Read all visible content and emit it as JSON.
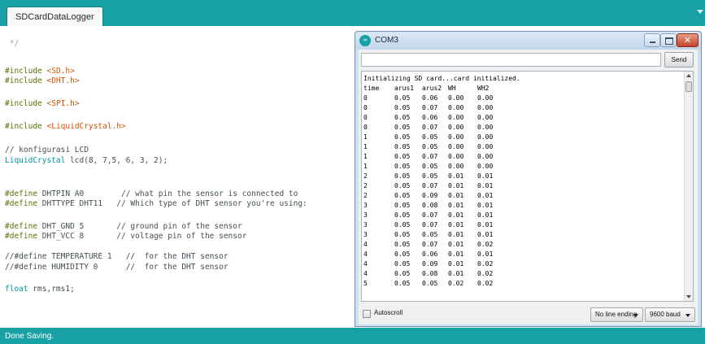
{
  "editor": {
    "tab_label": "SDCardDataLogger",
    "code_lines": [
      " */",
      "#include <SD.h>",
      "#include <DHT.h>",
      "#include <SPI.h>",
      "#include <LiquidCrystal.h>",
      "// konfigurasi LCD",
      "LiquidCrystal lcd(8, 7,5, 6, 3, 2);",
      "#define DHTPIN A0        // what pin the sensor is connected to",
      "#define DHTTYPE DHT11   // Which type of DHT sensor you're using:",
      "#define DHT_GND 5       // ground pin of the sensor",
      "#define DHT_VCC 8       // voltage pin of the sensor",
      "//#define TEMPERATURE 1   //  for the DHT sensor",
      "//#define HUMIDITY 0      //  for the DHT sensor",
      "float rms,rms1;"
    ]
  },
  "status": {
    "text": "Done Saving."
  },
  "serial_monitor": {
    "title": "COM3",
    "icon_text": "∞",
    "send_label": "Send",
    "init_line": "Initializing SD card...card initialized.",
    "columns": [
      "time",
      "arus1",
      "arus2",
      "WH",
      "WH2"
    ],
    "rows": [
      [
        "0",
        "0.05",
        "0.06",
        "0.00",
        "0.00"
      ],
      [
        "0",
        "0.05",
        "0.07",
        "0.00",
        "0.00"
      ],
      [
        "0",
        "0.05",
        "0.06",
        "0.00",
        "0.00"
      ],
      [
        "0",
        "0.05",
        "0.07",
        "0.00",
        "0.00"
      ],
      [
        "1",
        "0.05",
        "0.05",
        "0.00",
        "0.00"
      ],
      [
        "1",
        "0.05",
        "0.05",
        "0.00",
        "0.00"
      ],
      [
        "1",
        "0.05",
        "0.07",
        "0.00",
        "0.00"
      ],
      [
        "1",
        "0.05",
        "0.05",
        "0.00",
        "0.00"
      ],
      [
        "2",
        "0.05",
        "0.05",
        "0.01",
        "0.01"
      ],
      [
        "2",
        "0.05",
        "0.07",
        "0.01",
        "0.01"
      ],
      [
        "2",
        "0.05",
        "0.09",
        "0.01",
        "0.01"
      ],
      [
        "3",
        "0.05",
        "0.08",
        "0.01",
        "0.01"
      ],
      [
        "3",
        "0.05",
        "0.07",
        "0.01",
        "0.01"
      ],
      [
        "3",
        "0.05",
        "0.07",
        "0.01",
        "0.01"
      ],
      [
        "3",
        "0.05",
        "0.05",
        "0.01",
        "0.01"
      ],
      [
        "4",
        "0.05",
        "0.07",
        "0.01",
        "0.02"
      ],
      [
        "4",
        "0.05",
        "0.06",
        "0.01",
        "0.01"
      ],
      [
        "4",
        "0.05",
        "0.09",
        "0.01",
        "0.02"
      ],
      [
        "4",
        "0.05",
        "0.08",
        "0.01",
        "0.02"
      ],
      [
        "5",
        "0.05",
        "0.05",
        "0.02",
        "0.02"
      ]
    ],
    "autoscroll_label": "Autoscroll",
    "line_ending": "No line ending",
    "baud": "9600 baud"
  },
  "colors": {
    "frame_teal": "#17a1a5",
    "include_orange": "#d35400",
    "type_teal": "#00979c",
    "directive_olive": "#5e6d03"
  }
}
